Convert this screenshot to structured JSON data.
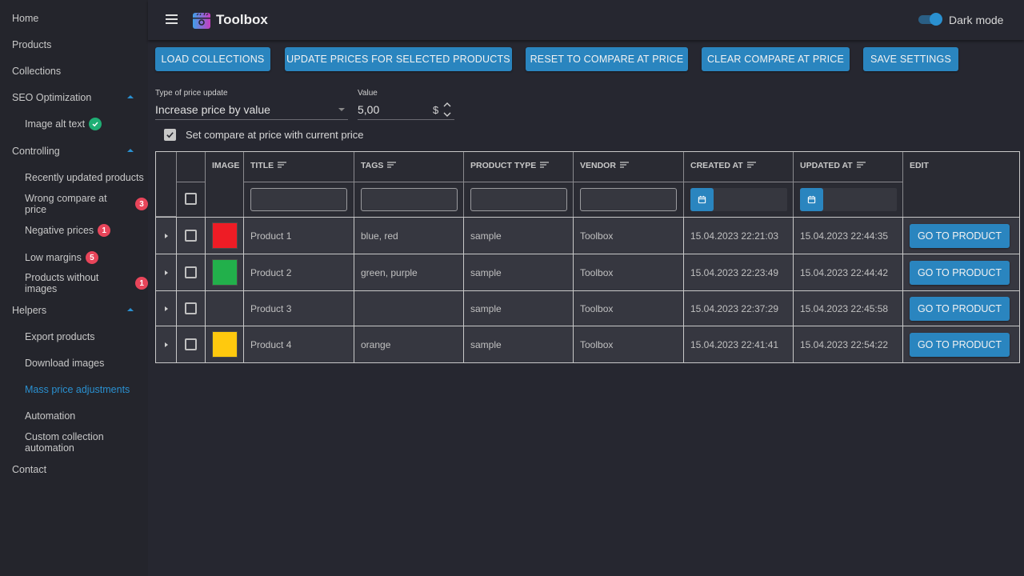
{
  "sidebar": {
    "items": [
      {
        "label": "Home",
        "level": "top"
      },
      {
        "label": "Products",
        "level": "top"
      },
      {
        "label": "Collections",
        "level": "top"
      },
      {
        "label": "SEO Optimization",
        "level": "top",
        "expanded": true
      },
      {
        "label": "Image alt text",
        "level": "sub",
        "badge_icon": "check-icon"
      },
      {
        "label": "Controlling",
        "level": "top",
        "expanded": true
      },
      {
        "label": "Recently updated products",
        "level": "sub"
      },
      {
        "label": "Wrong compare at price",
        "level": "sub",
        "badge": "3"
      },
      {
        "label": "Negative prices",
        "level": "sub",
        "badge": "1"
      },
      {
        "label": "Low margins",
        "level": "sub",
        "badge": "5"
      },
      {
        "label": "Products without images",
        "level": "sub",
        "badge": "1"
      },
      {
        "label": "Helpers",
        "level": "top",
        "expanded": true
      },
      {
        "label": "Export products",
        "level": "sub"
      },
      {
        "label": "Download images",
        "level": "sub"
      },
      {
        "label": "Mass price adjustments",
        "level": "sub",
        "active": true
      },
      {
        "label": "Automation",
        "level": "sub"
      },
      {
        "label": "Custom collection automation",
        "level": "sub"
      },
      {
        "label": "Contact",
        "level": "top"
      }
    ]
  },
  "header": {
    "title": "Toolbox",
    "dark_mode_label": "Dark mode",
    "dark_mode_on": true
  },
  "toolbar": {
    "load_collections": "LOAD COLLECTIONS",
    "update_prices": "UPDATE PRICES FOR SELECTED PRODUCTS",
    "reset_compare": "RESET TO COMPARE AT PRICE",
    "clear_compare": "CLEAR COMPARE AT PRICE",
    "save_settings": "SAVE SETTINGS"
  },
  "form": {
    "type_label": "Type of price update",
    "type_value": "Increase price by value",
    "value_label": "Value",
    "value": "5,00",
    "currency": "$",
    "compare_checkbox_label": "Set compare at price with current price",
    "compare_checked": true
  },
  "table": {
    "columns": {
      "image": "IMAGE",
      "title": "TITLE",
      "tags": "TAGS",
      "product_type": "PRODUCT TYPE",
      "vendor": "VENDOR",
      "created_at": "CREATED AT",
      "updated_at": "UPDATED AT",
      "edit": "EDIT"
    },
    "go_label": "GO TO PRODUCT",
    "rows": [
      {
        "title": "Product 1",
        "tags": "blue, red",
        "product_type": "sample",
        "vendor": "Toolbox",
        "created_at": "15.04.2023 22:21:03",
        "updated_at": "15.04.2023 22:44:35",
        "image_color": "#ee1c25"
      },
      {
        "title": "Product 2",
        "tags": "green, purple",
        "product_type": "sample",
        "vendor": "Toolbox",
        "created_at": "15.04.2023 22:23:49",
        "updated_at": "15.04.2023 22:44:42",
        "image_color": "#22b04b"
      },
      {
        "title": "Product 3",
        "tags": "",
        "product_type": "sample",
        "vendor": "Toolbox",
        "created_at": "15.04.2023 22:37:29",
        "updated_at": "15.04.2023 22:45:58",
        "image_color": ""
      },
      {
        "title": "Product 4",
        "tags": "orange",
        "product_type": "sample",
        "vendor": "Toolbox",
        "created_at": "15.04.2023 22:41:41",
        "updated_at": "15.04.2023 22:54:22",
        "image_color": "#ffc90e"
      }
    ]
  },
  "colors": {
    "accent": "#2a85bf",
    "active_link": "#2a90d0",
    "badge": "#e8455a",
    "badge_ok": "#1fae74"
  }
}
